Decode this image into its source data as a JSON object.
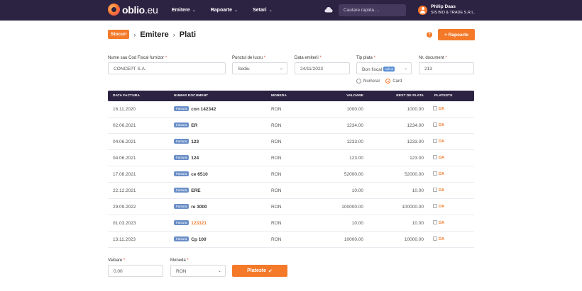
{
  "navbar": {
    "logo_main": "oblio",
    "logo_suffix": ".eu",
    "menu": [
      {
        "label": "Emitere"
      },
      {
        "label": "Rapoarte"
      },
      {
        "label": "Setari"
      }
    ],
    "search_placeholder": "Cautare rapida ...",
    "user": {
      "name": "Philip Daas",
      "company": "SIS BIO & TRADE S.R.L."
    }
  },
  "header": {
    "badge": "Stocuri",
    "crumb_1": "Emitere",
    "crumb_2": "Plati",
    "help": "?",
    "rapoarte_button": "+ Rapoarte"
  },
  "form": {
    "supplier": {
      "label": "Nume sau Cod Fiscal furnizor",
      "value": "CONCEPT S.A."
    },
    "work_point": {
      "label": "Punctul de lucru",
      "value": "Sediu"
    },
    "date": {
      "label": "Data emiterii",
      "value": "24/11/2023"
    },
    "payment_type": {
      "label": "Tip plata",
      "value": "Bon fiscal",
      "badge": "online"
    },
    "doc_number": {
      "label": "Nr. document",
      "value": "213"
    },
    "radio": {
      "numerar": "Numerar",
      "card": "Card",
      "selected": "card"
    },
    "required_mark": "*"
  },
  "table": {
    "headers": [
      "DATA FACTURA",
      "NUMAR DOCUMENT",
      "MONEDA",
      "VALOARE",
      "REST DE PLATA",
      "PLATESTE"
    ],
    "rows": [
      {
        "date": "16.11.2020",
        "type": "Factura",
        "number": "con 142342",
        "currency": "RON",
        "value": "1000.00",
        "rest": "1000.00",
        "pay": "DA",
        "highlight": false
      },
      {
        "date": "02.06.2021",
        "type": "Factura",
        "number": "ER",
        "currency": "RON",
        "value": "1234.00",
        "rest": "1234.00",
        "pay": "DA",
        "highlight": false
      },
      {
        "date": "04.06.2021",
        "type": "Factura",
        "number": "123",
        "currency": "RON",
        "value": "1233.00",
        "rest": "1233.00",
        "pay": "DA",
        "highlight": false
      },
      {
        "date": "04.06.2021",
        "type": "Factura",
        "number": "124",
        "currency": "RON",
        "value": "123.00",
        "rest": "123.00",
        "pay": "DA",
        "highlight": false
      },
      {
        "date": "17.08.2021",
        "type": "Factura",
        "number": "ce 6510",
        "currency": "RON",
        "value": "52000.00",
        "rest": "52000.00",
        "pay": "DA",
        "highlight": false
      },
      {
        "date": "22.12.2021",
        "type": "Factura",
        "number": "ERE",
        "currency": "RON",
        "value": "10.00",
        "rest": "10.00",
        "pay": "DA",
        "highlight": false
      },
      {
        "date": "29.09.2022",
        "type": "Factura",
        "number": "re 3000",
        "currency": "RON",
        "value": "100000.00",
        "rest": "100000.00",
        "pay": "DA",
        "highlight": false
      },
      {
        "date": "01.03.2023",
        "type": "Factura",
        "number": "123321",
        "currency": "RON",
        "value": "10.00",
        "rest": "10.00",
        "pay": "DA",
        "highlight": true
      },
      {
        "date": "13.11.2023",
        "type": "Factura",
        "number": "Cp 100",
        "currency": "RON",
        "value": "10000.00",
        "rest": "10000.00",
        "pay": "DA",
        "highlight": false
      }
    ]
  },
  "bottom": {
    "amount": {
      "label": "Valoare",
      "value": "0.00"
    },
    "currency": {
      "label": "Moneda",
      "value": "RON"
    },
    "pay_button": "Plateste",
    "pay_icon": "check-icon"
  },
  "colors": {
    "primary": "#2c2242",
    "accent": "#f47a2a",
    "badge_blue": "#6b8fc7"
  }
}
